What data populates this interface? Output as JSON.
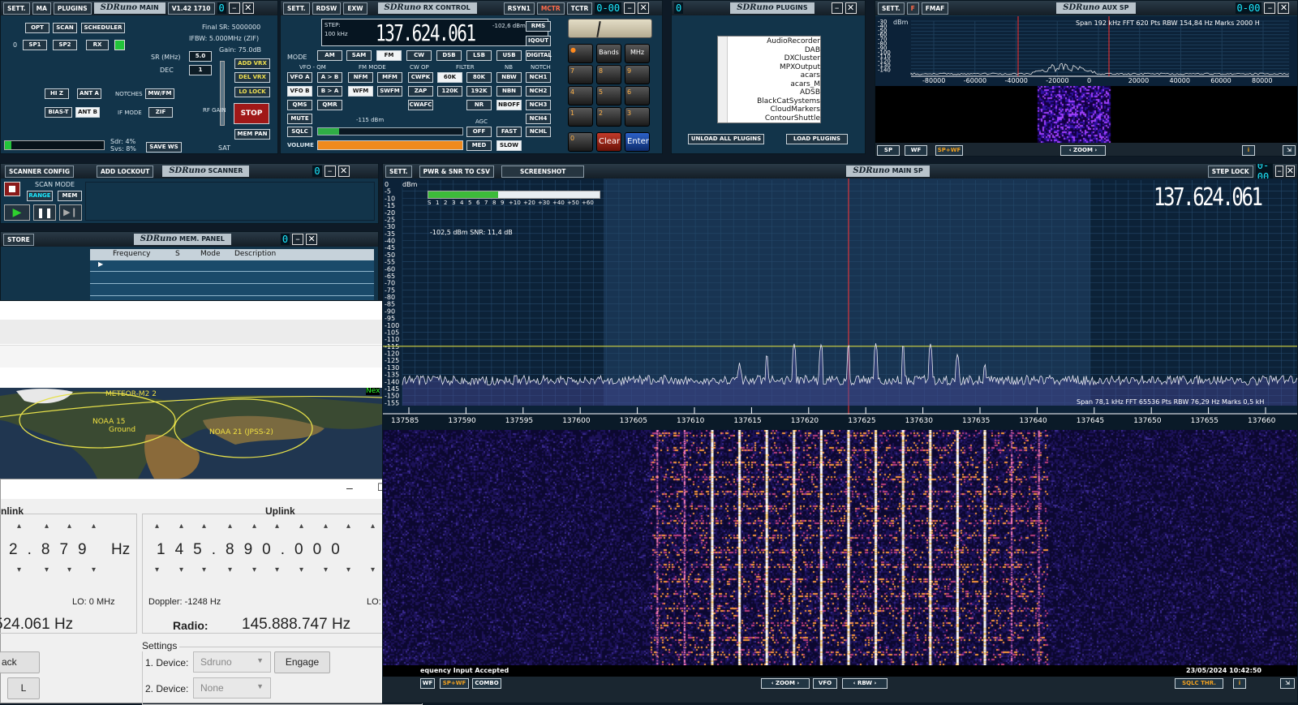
{
  "main": {
    "sett": "SETT.",
    "ma": "MA",
    "plugins": "PLUGINS",
    "title": "SDRuno",
    "sub": "MAIN",
    "version": "V1.42 1710",
    "opt": "OPT",
    "scan": "SCAN",
    "scheduler": "SCHEDULER",
    "sp1": "SP1",
    "sp2": "SP2",
    "rx": "RX",
    "zero": "0",
    "final_sr": "Final SR: 5000000",
    "ifbw": "IFBW: 5.000MHz (ZIF)",
    "gain": "Gain: 75.0dB",
    "sr_label": "SR (MHz)",
    "sr_value": "5.0",
    "dec_label": "DEC",
    "dec_value": "1",
    "add_vrx": "ADD VRX",
    "del_vrx": "DEL VRX",
    "lo_lock": "LO LOCK",
    "hiz": "HI Z",
    "ant_a": "ANT A",
    "notches": "NOTCHES",
    "mwfm": "MW/FM",
    "bias_t": "BIAS-T",
    "ant_b": "ANT B",
    "if_mode": "IF MODE",
    "zif": "ZIF",
    "rf_gain": "RF GAIN",
    "stop": "STOP",
    "mem_pan": "MEM PAN",
    "sdr": "Sdr: 4%",
    "svs": "Svs: 8%",
    "save_ws": "SAVE WS",
    "sat": "SAT"
  },
  "rx": {
    "sett": "SETT.",
    "rdsw": "RDSW",
    "exw": "EXW",
    "title": "SDRuno",
    "sub": "RX CONTROL",
    "rsyn1": "RSYN1",
    "mctr": "MCTR",
    "tctr": "TCTR",
    "step": "STEP:",
    "step_val": "100 kHz",
    "freq": "137.624.061",
    "dbm": "-102,6 dBm",
    "rms": "RMS",
    "iqout": "IQOUT",
    "digital": "DIGITAL",
    "mode": "MODE",
    "am": "AM",
    "sam": "SAM",
    "fm": "FM",
    "cw": "CW",
    "dsb": "DSB",
    "lsb": "LSB",
    "usb": "USB",
    "vfo_qm": "VFO - QM",
    "fm_mode": "FM MODE",
    "cw_op": "CW OP",
    "filter": "FILTER",
    "nb": "NB",
    "notch": "NOTCH",
    "vfo_a": "VFO A",
    "a_to_b": "A > B",
    "nfm": "NFM",
    "mfm": "MFM",
    "cwpk": "CWPK",
    "f60k": "60K",
    "f80k": "80K",
    "nbw": "NBW",
    "nch1": "NCH1",
    "vfo_b": "VFO B",
    "b_to_a": "B > A",
    "wfm": "WFM",
    "swfm": "SWFM",
    "zap": "ZAP",
    "f120k": "120K",
    "f192k": "192K",
    "nbn": "NBN",
    "nch2": "NCH2",
    "qms": "QMS",
    "qmr": "QMR",
    "cwafc": "CWAFC",
    "nr": "NR",
    "nboff": "NBOFF",
    "nch3": "NCH3",
    "mute": "MUTE",
    "sq_dbm": "-115 dBm",
    "agc": "AGC",
    "nch4": "NCH4",
    "sqlc": "SQLC",
    "off": "OFF",
    "fast": "FAST",
    "nchl": "NCHL",
    "volume": "VOLUME",
    "med": "MED",
    "slow": "SLOW",
    "bands": "Bands",
    "mhz": "MHz",
    "clear": "Clear",
    "enter": "Enter",
    "keys": [
      "7",
      "8",
      "9",
      "4",
      "5",
      "6",
      "1",
      "2",
      "3",
      "0"
    ]
  },
  "plugins": {
    "title": "SDRuno",
    "sub": "PLUGINS",
    "list": [
      "AudioRecorder",
      "DAB",
      "DXCluster",
      "MPXOutput",
      "acars",
      "acars_M",
      "ADSB",
      "BlackCatSystems",
      "CloudMarkers",
      "ContourShuttle"
    ],
    "unload": "UNLOAD ALL PLUGINS",
    "load": "LOAD PLUGINS"
  },
  "aux": {
    "sett": "SETT.",
    "f": "F",
    "fmaf": "FMAF",
    "title": "SDRuno",
    "sub": "AUX SP",
    "info": "Span 192 kHz  FFT 620 Pts  RBW 154,84 Hz  Marks 2000 H",
    "dbm": "dBm",
    "yticks": [
      "-30",
      "-40",
      "-50",
      "-60",
      "-70",
      "-80",
      "-90",
      "-100",
      "-110",
      "-120",
      "-130",
      "-140"
    ],
    "xticks": [
      "-80000",
      "-60000",
      "-40000",
      "-20000",
      "0",
      "20000",
      "40000",
      "60000",
      "80000"
    ],
    "sp": "SP",
    "wf": "WF",
    "spwf": "SP+WF",
    "zoom": "ZOOM",
    "i": "i"
  },
  "scanner": {
    "config": "SCANNER CONFIG",
    "lockout": "ADD LOCKOUT",
    "title": "SDRuno",
    "sub": "SCANNER",
    "scan_mode": "SCAN MODE",
    "range": "RANGE",
    "mem": "MEM"
  },
  "mem": {
    "store": "STORE",
    "title": "SDRuno",
    "sub": "MEM. PANEL",
    "cols": [
      "Frequency",
      "S",
      "Mode",
      "Description"
    ]
  },
  "map": {
    "sats": [
      "METEOR-M2 2",
      "NOAA 15",
      "Ground",
      "NOAA 21 (JPSS-2)"
    ],
    "next": "Nex"
  },
  "doppler": {
    "downlink": "nlink",
    "uplink": "Uplink",
    "down_digits": [
      "2",
      ".",
      "8",
      "7",
      "9"
    ],
    "hz": "Hz",
    "up_digits": [
      "1",
      "4",
      "5",
      ".",
      "8",
      "9",
      "0",
      ".",
      "0",
      "0",
      "0"
    ],
    "lo": "LO: 0 MHz",
    "doppler": "Doppler: -1248 Hz",
    "down_freq": "524.061 Hz",
    "radio": "Radio:",
    "radio_freq": "145.888.747 Hz",
    "settings": "Settings",
    "dev1": "1. Device:",
    "dev1_val": "Sdruno",
    "engage": "Engage",
    "dev2": "2. Device:",
    "dev2_val": "None",
    "back": "ack",
    "l": "L"
  },
  "mainsp": {
    "sett": "SETT.",
    "pwr": "PWR & SNR TO CSV",
    "screenshot": "SCREENSHOT",
    "title": "SDRuno",
    "sub": "MAIN SP",
    "step_lock": "STEP LOCK",
    "freq": "137.624.061",
    "smeter": [
      "S",
      "1",
      "2",
      "3",
      "4",
      "5",
      "6",
      "7",
      "8",
      "9",
      "+10",
      "+20",
      "+30",
      "+40",
      "+50",
      "+60"
    ],
    "readout": "-102,5 dBm   SNR: 11,4 dB",
    "dbm": "dBm",
    "info": "Span 78,1 kHz  FFT 65536 Pts  RBW 76,29 Hz  Marks 0,5 kH",
    "status": "equency Input Accepted",
    "datetime": "23/05/2024 10:42:50",
    "wf": "WF",
    "spwf": "SP+WF",
    "combo": "COMBO",
    "zoom": "ZOOM",
    "vfo": "VFO",
    "rbw": "RBW",
    "sqlc_thr": "SQLC THR.",
    "i": "i",
    "yticks": [
      "0",
      "-5",
      "-10",
      "-15",
      "-20",
      "-25",
      "-30",
      "-35",
      "-40",
      "-45",
      "-50",
      "-55",
      "-60",
      "-65",
      "-70",
      "-75",
      "-80",
      "-85",
      "-90",
      "-95",
      "-100",
      "-105",
      "-110",
      "-115",
      "-120",
      "-125",
      "-130",
      "-135",
      "-140",
      "-145",
      "-150",
      "-155"
    ],
    "xticks": [
      "137585",
      "137590",
      "137595",
      "137600",
      "137605",
      "137610",
      "137615",
      "137620",
      "137625",
      "137630",
      "137635",
      "137640",
      "137645",
      "137650",
      "137655",
      "137660"
    ]
  },
  "colors": {
    "panel": "#12344a",
    "spectrum": "#0c2238",
    "cyan": "#1de9ff",
    "squelch": "#d6d640",
    "marker": "#ff3030",
    "stop": "#a01818"
  }
}
